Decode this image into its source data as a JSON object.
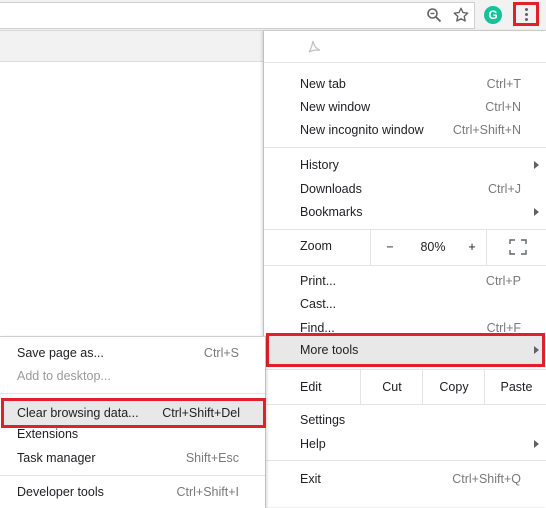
{
  "toolbar": {
    "zoom_icon": "magnifier-icon",
    "star_icon": "star-icon",
    "grammarly_icon": "grammarly-icon",
    "grammarly_letter": "G",
    "menu_icon": "kebab-icon"
  },
  "colors": {
    "highlight_border": "#e0202b",
    "hover_bg": "#e8e8e8",
    "grammarly": "#15c39a"
  },
  "menu": {
    "pdf_icon": "acrobat-pdf-icon",
    "new_tab": {
      "label": "New tab",
      "shortcut": "Ctrl+T"
    },
    "new_window": {
      "label": "New window",
      "shortcut": "Ctrl+N"
    },
    "new_incognito": {
      "label": "New incognito window",
      "shortcut": "Ctrl+Shift+N"
    },
    "history": {
      "label": "History"
    },
    "downloads": {
      "label": "Downloads",
      "shortcut": "Ctrl+J"
    },
    "bookmarks": {
      "label": "Bookmarks"
    },
    "zoom": {
      "label": "Zoom",
      "minus": "−",
      "value": "80%",
      "plus": "+",
      "fullscreen_icon": "fullscreen-icon"
    },
    "print": {
      "label": "Print...",
      "shortcut": "Ctrl+P"
    },
    "cast": {
      "label": "Cast..."
    },
    "find": {
      "label": "Find...",
      "shortcut": "Ctrl+F"
    },
    "more_tools": {
      "label": "More tools"
    },
    "edit": {
      "label": "Edit",
      "cut": "Cut",
      "copy": "Copy",
      "paste": "Paste"
    },
    "settings": {
      "label": "Settings"
    },
    "help": {
      "label": "Help"
    },
    "exit": {
      "label": "Exit",
      "shortcut": "Ctrl+Shift+Q"
    }
  },
  "submenu": {
    "save_page": {
      "label": "Save page as...",
      "shortcut": "Ctrl+S"
    },
    "add_desktop": {
      "label": "Add to desktop..."
    },
    "clear_data": {
      "label": "Clear browsing data...",
      "shortcut": "Ctrl+Shift+Del"
    },
    "extensions": {
      "label": "Extensions"
    },
    "task_manager": {
      "label": "Task manager",
      "shortcut": "Shift+Esc"
    },
    "developer_tools": {
      "label": "Developer tools",
      "shortcut": "Ctrl+Shift+I"
    }
  }
}
